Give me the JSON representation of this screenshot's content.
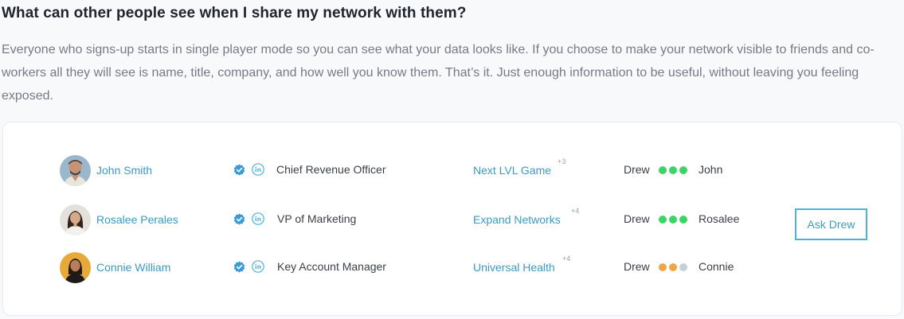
{
  "heading": "What can other people see when I share my network with them?",
  "intro": "Everyone who signs-up starts in single player mode so you can see what your data looks like. If you choose to make your network visible to friends and co-workers all they will see is name, title, company, and how well you know them. That’s it. Just enough information to be useful, without leaving you feeling exposed.",
  "colors": {
    "link": "#3a9bc5",
    "strong": "#3cd464",
    "medium": "#f0a646",
    "weak": "#c8ced6",
    "button_border": "#4ab3dc"
  },
  "contacts": [
    {
      "name": "John Smith",
      "title": "Chief Revenue Officer",
      "company": "Next LVL Game",
      "company_extra": "+3",
      "from": "Drew",
      "to": "John",
      "strength_dots": [
        "#3cd464",
        "#3cd464",
        "#3cd464"
      ],
      "avatar_bg": "#9ab7cc"
    },
    {
      "name": "Rosalee Perales",
      "title": "VP of Marketing",
      "company": "Expand Networks",
      "company_extra": "+4",
      "from": "Drew",
      "to": "Rosalee",
      "strength_dots": [
        "#3cd464",
        "#3cd464",
        "#3cd464"
      ],
      "avatar_bg": "#e4e0db"
    },
    {
      "name": "Connie William",
      "title": "Key Account Manager",
      "company": "Universal Health",
      "company_extra": "+4",
      "from": "Drew",
      "to": "Connie",
      "strength_dots": [
        "#f0a646",
        "#f0a646",
        "#c8ced6"
      ],
      "avatar_bg": "#e7a93a"
    }
  ],
  "ask_button": "Ask Drew",
  "icons": {
    "verified": "verified-check-icon",
    "linkedin": "linkedin-icon"
  }
}
